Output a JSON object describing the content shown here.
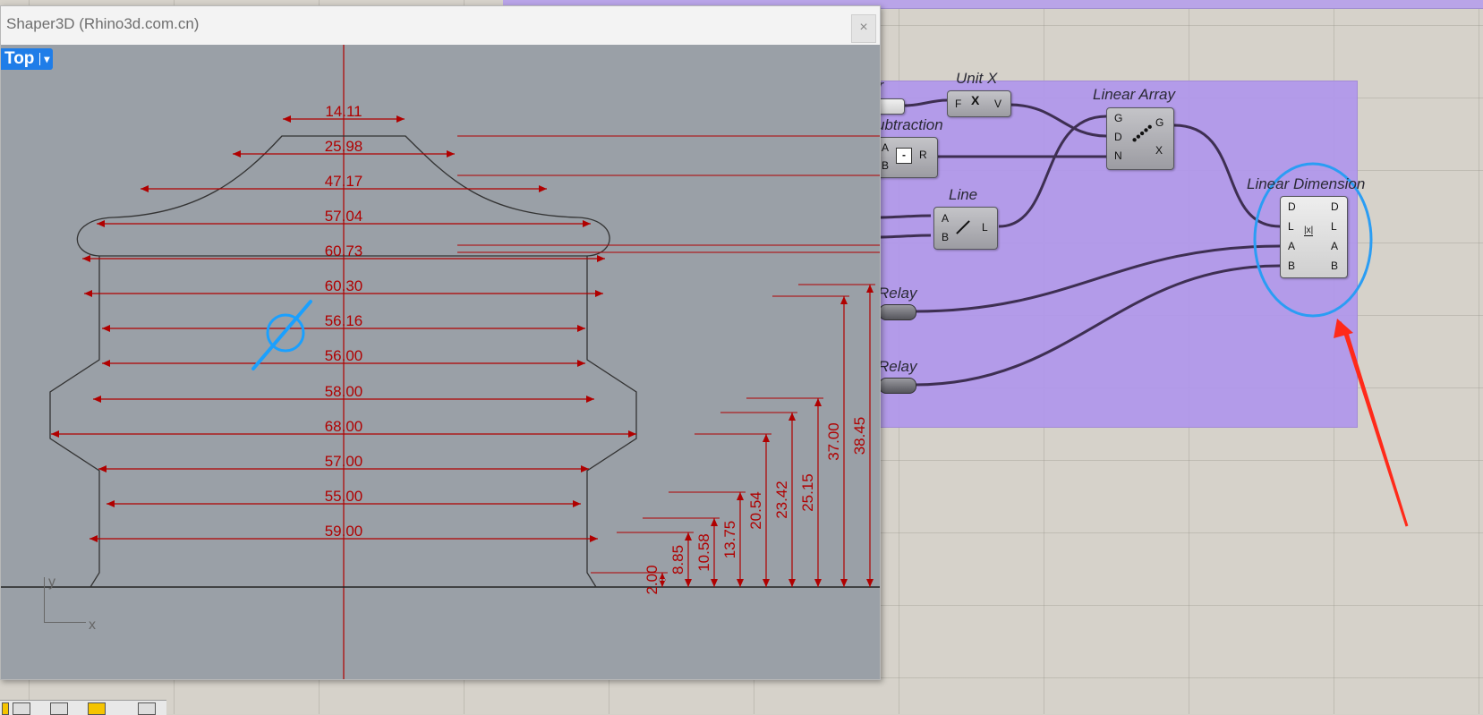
{
  "window": {
    "title": "Shaper3D (Rhino3d.com.cn)",
    "close_label": "×"
  },
  "viewport": {
    "name": "Top",
    "dropdown_arrow": "▾",
    "axis_y": "y",
    "axis_x": "x",
    "horizontal_dims": [
      "14.11",
      "25.98",
      "47.17",
      "57.04",
      "60.73",
      "60.30",
      "56.16",
      "56.00",
      "58.00",
      "68.00",
      "57.00",
      "55.00",
      "59.00"
    ],
    "vertical_dims": [
      "2.00",
      "8.85",
      "10.58",
      "13.75",
      "20.54",
      "23.42",
      "25.15",
      "37.00",
      "38.45"
    ]
  },
  "grasshopper": {
    "nodes": {
      "partial_slider_title": "er",
      "unit_x": {
        "title": "Unit X",
        "in": "F",
        "out": "V"
      },
      "subtraction": {
        "title": "ubtraction",
        "in_a": "A",
        "in_b": "B",
        "out": "R",
        "icon": "-"
      },
      "linear_array": {
        "title": "Linear Array",
        "in_g": "G",
        "in_d": "D",
        "in_n": "N",
        "out_g": "G",
        "out_x": "X"
      },
      "line": {
        "title": "Line",
        "in_a": "A",
        "in_b": "B",
        "out": "L"
      },
      "linear_dimension": {
        "title": "Linear Dimension",
        "in_d": "D",
        "in_l": "L",
        "in_a": "A",
        "in_b": "B",
        "out_d": "D",
        "out_l": "L",
        "out_a": "A",
        "out_b": "B"
      },
      "relay_1": {
        "title": "Relay"
      },
      "relay_2": {
        "title": "Relay"
      }
    }
  },
  "colors": {
    "dimension_red": "#b00000",
    "group_purple": "#b096ec",
    "highlight_blue": "#2a9df4",
    "annotation_arrow": "#ff2a1a"
  }
}
